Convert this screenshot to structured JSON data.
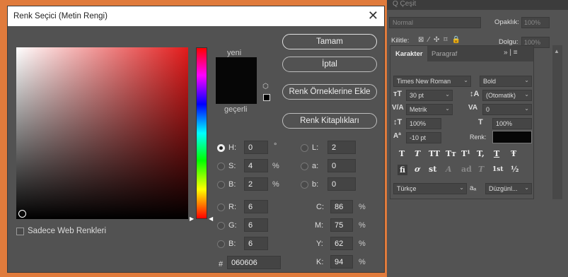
{
  "dialog": {
    "title": "Renk Seçici (Metin Rengi)",
    "close_glyph": "✕",
    "new_label": "yeni",
    "current_label": "geçerli",
    "new_color": "#060606",
    "current_color": "#060606",
    "field_hue_color": "#e21b1b",
    "buttons": {
      "ok": "Tamam",
      "cancel": "İptal",
      "add_swatches": "Renk Örneklerine Ekle",
      "libraries": "Renk Kitaplıkları"
    },
    "web_colors_label": "Sadece Web Renkleri",
    "fields": {
      "h": {
        "label": "H:",
        "value": "0",
        "unit": "°"
      },
      "s": {
        "label": "S:",
        "value": "4",
        "unit": "%"
      },
      "b": {
        "label": "B:",
        "value": "2",
        "unit": "%"
      },
      "r": {
        "label": "R:",
        "value": "6"
      },
      "g": {
        "label": "G:",
        "value": "6"
      },
      "bb": {
        "label": "B:",
        "value": "6"
      },
      "l": {
        "label": "L:",
        "value": "2"
      },
      "a": {
        "label": "a:",
        "value": "0"
      },
      "lab_b": {
        "label": "b:",
        "value": "0"
      },
      "c": {
        "label": "C:",
        "value": "86",
        "unit": "%"
      },
      "m": {
        "label": "M:",
        "value": "75",
        "unit": "%"
      },
      "y": {
        "label": "Y:",
        "value": "62",
        "unit": "%"
      },
      "k": {
        "label": "K:",
        "value": "94",
        "unit": "%"
      },
      "hex": {
        "label": "#",
        "value": "060606"
      }
    }
  },
  "ps": {
    "search": "Q Çeşit",
    "blend_mode": "Normal",
    "opacity_label": "Opaklık:",
    "opacity_value": "100%",
    "lock_label": "Kilitle:",
    "fill_label": "Dolgu:",
    "fill_value": "100%",
    "tabs": {
      "character": "Karakter",
      "paragraph": "Paragraf"
    },
    "panel_menu": "» | ≡",
    "font_family": "Times New Roman",
    "font_style": "Bold",
    "font_size": "30 pt",
    "leading": "(Otomatik)",
    "kerning": "Metrik",
    "tracking": "0",
    "vscale": "100%",
    "hscale": "100%",
    "baseline": "-10 pt",
    "color_label": "Renk:",
    "text_color": "#060606",
    "style_buttons": [
      "T",
      "T",
      "TT",
      "Tт",
      "T¹",
      "T,",
      "T",
      "Ŧ"
    ],
    "opentype_buttons": [
      "fi",
      "ơ",
      "st",
      "A",
      "ad",
      "T",
      "1st",
      "½"
    ],
    "language": "Türkçe",
    "aa_label": "aₐ",
    "antialias": "Düzgünl..."
  }
}
